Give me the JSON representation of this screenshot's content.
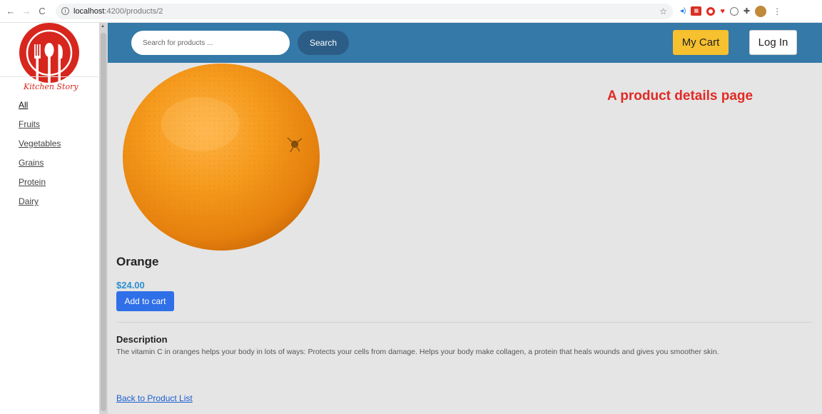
{
  "browser": {
    "url_host": "localhost",
    "url_path": ":4200/products/2"
  },
  "brand": {
    "logo_text": "Kitchen Story",
    "logo_color": "#d7261e"
  },
  "sidebar": {
    "categories": [
      {
        "label": "All",
        "active": true
      },
      {
        "label": "Fruits"
      },
      {
        "label": "Vegetables"
      },
      {
        "label": "Grains"
      },
      {
        "label": "Protein"
      },
      {
        "label": "Dairy"
      }
    ]
  },
  "header": {
    "search_placeholder": "Search for products ...",
    "search_label": "Search",
    "cart_label": "My Cart",
    "login_label": "Log In",
    "bar_color": "#3479a7"
  },
  "annotation": "A product details page",
  "product": {
    "name": "Orange",
    "price": "$24.00",
    "add_to_cart_label": "Add to cart",
    "description_heading": "Description",
    "description": "The vitamin C in oranges helps your body in lots of ways: Protects your cells from damage. Helps your body make collagen, a protein that heals wounds and gives you smoother skin.",
    "image_icon": "orange-fruit"
  },
  "back_link": "Back to Product List"
}
